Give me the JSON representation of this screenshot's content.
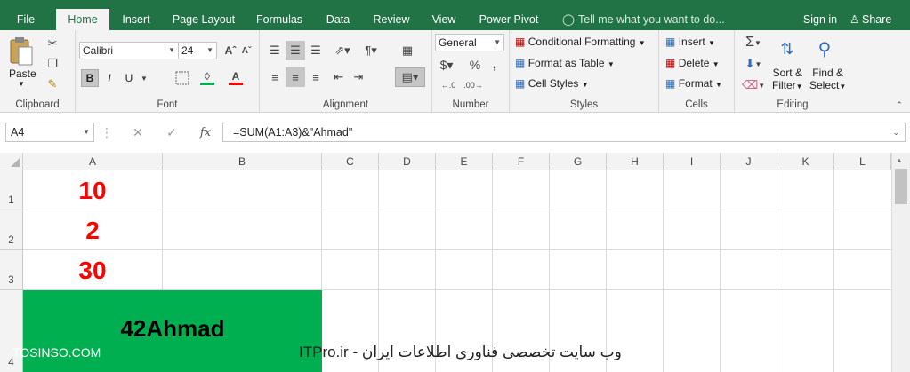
{
  "tabs": [
    {
      "label": "File",
      "active": false
    },
    {
      "label": "Home",
      "active": true
    },
    {
      "label": "Insert",
      "active": false
    },
    {
      "label": "Page Layout",
      "active": false
    },
    {
      "label": "Formulas",
      "active": false
    },
    {
      "label": "Data",
      "active": false
    },
    {
      "label": "Review",
      "active": false
    },
    {
      "label": "View",
      "active": false
    },
    {
      "label": "Power Pivot",
      "active": false
    }
  ],
  "tell_me": "Tell me what you want to do...",
  "sign_in": "Sign in",
  "share": "Share",
  "ribbon": {
    "clipboard": {
      "paste": "Paste",
      "label": "Clipboard"
    },
    "font": {
      "name": "Calibri",
      "size": "24",
      "bold": "B",
      "italic": "I",
      "underline": "U",
      "label": "Font"
    },
    "alignment": {
      "label": "Alignment"
    },
    "number": {
      "format": "General",
      "label": "Number",
      "dollar": "$",
      "percent": "%",
      "comma": ","
    },
    "styles": {
      "conditional": "Conditional Formatting",
      "format_table": "Format as Table",
      "cell_styles": "Cell Styles",
      "label": "Styles"
    },
    "cells": {
      "insert": "Insert",
      "delete": "Delete",
      "format": "Format",
      "label": "Cells"
    },
    "editing": {
      "sort": "Sort &",
      "filter": "Filter",
      "find": "Find &",
      "select": "Select",
      "label": "Editing"
    }
  },
  "formula_bar": {
    "name_box": "A4",
    "fx": "fx",
    "formula": "=SUM(A1:A3)&\"Ahmad\""
  },
  "columns": [
    "A",
    "B",
    "C",
    "D",
    "E",
    "F",
    "G",
    "H",
    "I",
    "J",
    "K",
    "L"
  ],
  "rows": [
    "1",
    "2",
    "3",
    "4"
  ],
  "cells": {
    "A1": "10",
    "A2": "2",
    "A3": "30",
    "A4": "42Ahmad"
  },
  "colors": {
    "accent": "#217346",
    "cell_fill_a4": "#00b050",
    "value_red": "#ff0000"
  },
  "watermark": {
    "left": "TOSINSO.COM",
    "right": "وب سایت تخصصی فناوری اطلاعات ایران - ITPro.ir"
  }
}
